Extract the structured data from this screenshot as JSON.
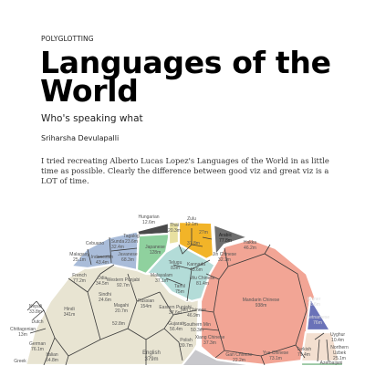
{
  "article": {
    "kicker": "POLYGLOTTING",
    "title": "Languages of the World",
    "subtitle": "Who's speaking what",
    "author": "Sriharsha Devulapalli",
    "description": "I tried recreating Alberto Lucas Lopez's Languages of the World in as little time as possible. Clearly the difference between good viz and great viz is a LOT of time."
  },
  "chart_data": {
    "type": "treemap",
    "subtype": "voronoi",
    "units": "million speakers",
    "family_colors": {
      "indo_european": "#e8e4d2",
      "austronesian": "#a9bcd9",
      "uralic": "#4a4a4a",
      "japonic": "#8fd19e",
      "tai_kadai": "#e8e0a0",
      "niger_congo": "#f2b428",
      "dravidian": "#b3dcd8",
      "gray_family": "#6e6e6e",
      "sino_tibetan": "#f2a595",
      "austroasiatic": "#6a72b8",
      "turkic": "#f3dfd0",
      "other": "#c8c8cc"
    },
    "labels": [
      {
        "name": "Hungarian",
        "value": "12.6m"
      },
      {
        "name": "Thai",
        "value": "20.3m"
      },
      {
        "name": "Zulu",
        "value": "12.1m"
      },
      {
        "name": "",
        "value": "27m"
      },
      {
        "name": "",
        "value": "37.8m"
      },
      {
        "name": "Arabic",
        "value": "77.8m"
      },
      {
        "name": "Hakka",
        "value": "46.2m"
      },
      {
        "name": "Jin Chinese",
        "value": "32.1m"
      },
      {
        "name": "Wu Chinese",
        "value": "81.4m"
      },
      {
        "name": "Mandarin Chinese",
        "value": "938m"
      },
      {
        "name": "Min Chinese",
        "value": "46.9m"
      },
      {
        "name": "Southern Min",
        "value": "50.3m"
      },
      {
        "name": "Xiang Chinese",
        "value": "37.3m"
      },
      {
        "name": "Gan Chinese",
        "value": "22.2m"
      },
      {
        "name": "Yue Chinese",
        "value": "73.1m"
      },
      {
        "name": "Khmer",
        "value": "16.6m"
      },
      {
        "name": "Vietnamese",
        "value": "76m"
      },
      {
        "name": "Turkish",
        "value": "79.4m"
      },
      {
        "name": "Uyghur",
        "value": "10.4m"
      },
      {
        "name": "Northern Uzbek",
        "value": "25.1m"
      },
      {
        "name": "Cebuano",
        "value": ""
      },
      {
        "name": "Tagalog",
        "value": "23.6m"
      },
      {
        "name": "Sunda",
        "value": "32.4m"
      },
      {
        "name": "Malagasy",
        "value": "25.1m"
      },
      {
        "name": "Indonesian",
        "value": "43.4m"
      },
      {
        "name": "Javanese",
        "value": "68.3m"
      },
      {
        "name": "Japanese",
        "value": "128m"
      },
      {
        "name": "Telugu",
        "value": "83m"
      },
      {
        "name": "Kannada",
        "value": "43.6m"
      },
      {
        "name": "Malayalam",
        "value": "37.1m"
      },
      {
        "name": "Tamil",
        "value": "75m"
      },
      {
        "name": "French",
        "value": "77.2m"
      },
      {
        "name": "Hindi",
        "value": "341m"
      },
      {
        "name": "Western Punjabi",
        "value": "92.7m"
      },
      {
        "name": "Russian",
        "value": "154m"
      },
      {
        "name": "Odia",
        "value": "34.5m"
      },
      {
        "name": "Sindhi",
        "value": "24.6m"
      },
      {
        "name": "Magahi",
        "value": "20.7m"
      },
      {
        "name": "",
        "value": "52.8m"
      },
      {
        "name": "Nepali",
        "value": "33.8m"
      },
      {
        "name": "Dutch",
        "value": ""
      },
      {
        "name": "Chittagonian",
        "value": "13m"
      },
      {
        "name": "German",
        "value": "76.1m"
      },
      {
        "name": "Italian",
        "value": "64.8m"
      },
      {
        "name": "Greek",
        "value": ""
      },
      {
        "name": "English",
        "value": "379m"
      },
      {
        "name": "Eastern Punjabi",
        "value": "37.6m"
      },
      {
        "name": "Gujarati",
        "value": "56.4m"
      },
      {
        "name": "Polish",
        "value": "39.7m"
      },
      {
        "name": "Azerbaijani",
        "value": ""
      }
    ]
  }
}
